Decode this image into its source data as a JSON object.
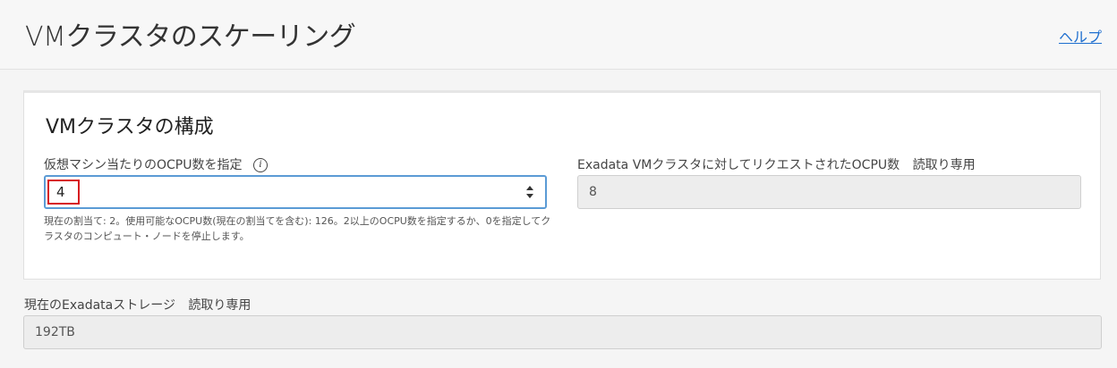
{
  "header": {
    "title": "VMクラスタのスケーリング",
    "help_link": "ヘルプ"
  },
  "card": {
    "title": "VMクラスタの構成",
    "ocpu_field": {
      "label": "仮想マシン当たりのOCPU数を指定",
      "value": "4",
      "help_text": "現在の割当て: 2。使用可能なOCPU数(現在の割当てを含む): 126。2以上のOCPU数を指定するか、0を指定してクラスタのコンピュート・ノードを停止します。"
    },
    "requested_field": {
      "label": "Exadata VMクラスタに対してリクエストされたOCPU数",
      "readonly_tag": "読取り専用",
      "value": "8"
    }
  },
  "storage": {
    "label": "現在のExadataストレージ",
    "readonly_tag": "読取り専用",
    "value": "192TB"
  },
  "colors": {
    "focus_border": "#5b9bd5",
    "highlight": "#d71920",
    "link": "#1f6fcf"
  }
}
